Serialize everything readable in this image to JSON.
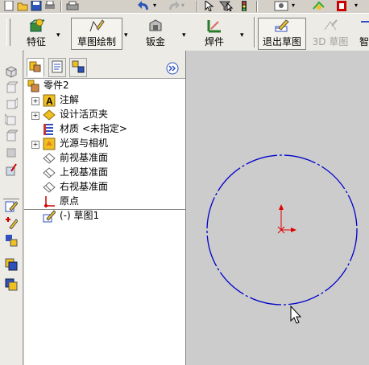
{
  "toolbar": {
    "features": "特征",
    "sketch": "草图绘制",
    "sheet_metal": "钣金",
    "weldments": "焊件",
    "exit_sketch": "退出草图",
    "sketch_3d": "3D 草图",
    "smart": "智"
  },
  "tree": {
    "part": "零件2",
    "annotations": "注解",
    "design_binder": "设计活页夹",
    "material": "材质 <未指定>",
    "lights_cameras": "光源与相机",
    "front_plane": "前视基准面",
    "top_plane": "上视基准面",
    "right_plane": "右视基准面",
    "origin": "原点",
    "sketch1": "(-) 草图1"
  },
  "colors": {
    "circle": "#0000cc",
    "origin": "#e00000",
    "canvas": "#cccccc"
  }
}
